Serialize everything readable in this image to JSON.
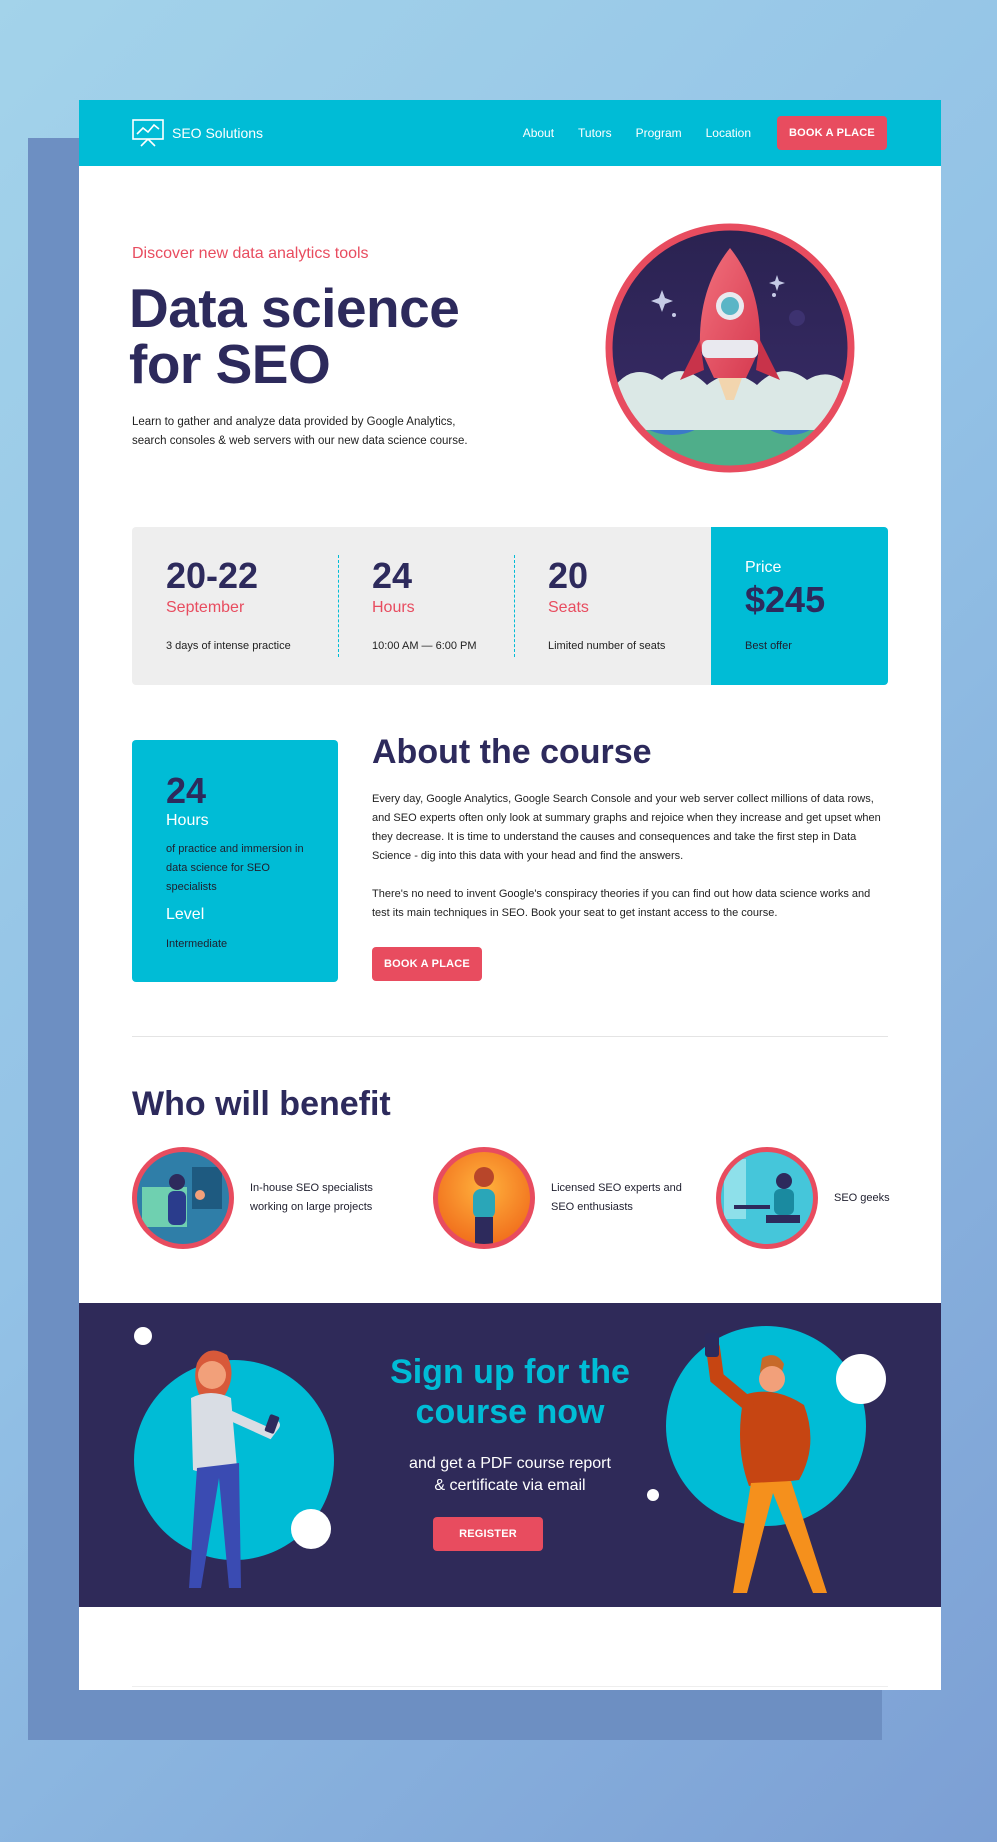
{
  "nav": {
    "brand": "SEO Solutions",
    "links": [
      "About",
      "Tutors",
      "Program",
      "Location"
    ],
    "cta": "BOOK A PLACE"
  },
  "hero": {
    "eyebrow": "Discover new data analytics tools",
    "title_line1": "Data science",
    "title_line2": "for SEO",
    "description_line1": "Learn to gather and analyze data provided by Google Analytics,",
    "description_line2": "search consoles & web servers with our new data science course."
  },
  "stats": [
    {
      "big": "20-22",
      "sub": "September",
      "note": "3 days of intense practice"
    },
    {
      "big": "24",
      "sub": "Hours",
      "note": "10:00 AM — 6:00 PM"
    },
    {
      "big": "20",
      "sub": "Seats",
      "note": "Limited number of seats"
    }
  ],
  "price": {
    "label": "Price",
    "value": "$245",
    "note": "Best offer"
  },
  "info_card": {
    "number": "24",
    "unit": "Hours",
    "desc": "of practice and immersion in data science for SEO specialists",
    "level_label": "Level",
    "level_value": "Intermediate"
  },
  "about": {
    "title": "About the course",
    "p1": "Every day, Google Analytics, Google Search Console and your web server collect millions of data rows, and SEO experts often only look at summary graphs and rejoice when they increase and get upset when they decrease. It is time to understand the causes and consequences and take the first step in Data Science - dig into this data with your head and find the answers.",
    "p2": "There's no need to invent Google's conspiracy theories if you can find out how data science works and test its main techniques in SEO. Book your seat to get instant access to the course.",
    "cta": "BOOK A PLACE"
  },
  "benefit": {
    "title": "Who will benefit",
    "items": [
      {
        "label": "In-house SEO specialists working on large projects"
      },
      {
        "label": "Licensed SEO experts and SEO enthusiasts"
      },
      {
        "label": "SEO geeks"
      }
    ]
  },
  "signup": {
    "title": "Sign up for the course now",
    "subtitle_line1": "and get a PDF course report",
    "subtitle_line2": "& certificate via email",
    "cta": "REGISTER"
  },
  "colors": {
    "accent": "#00bcd6",
    "brand_red": "#e84c5f",
    "navy": "#2d2a5c",
    "signup_bg": "#2f2a59"
  },
  "icons": {
    "brand": "presentation-chart-icon",
    "hero": "rocket-illustration"
  }
}
